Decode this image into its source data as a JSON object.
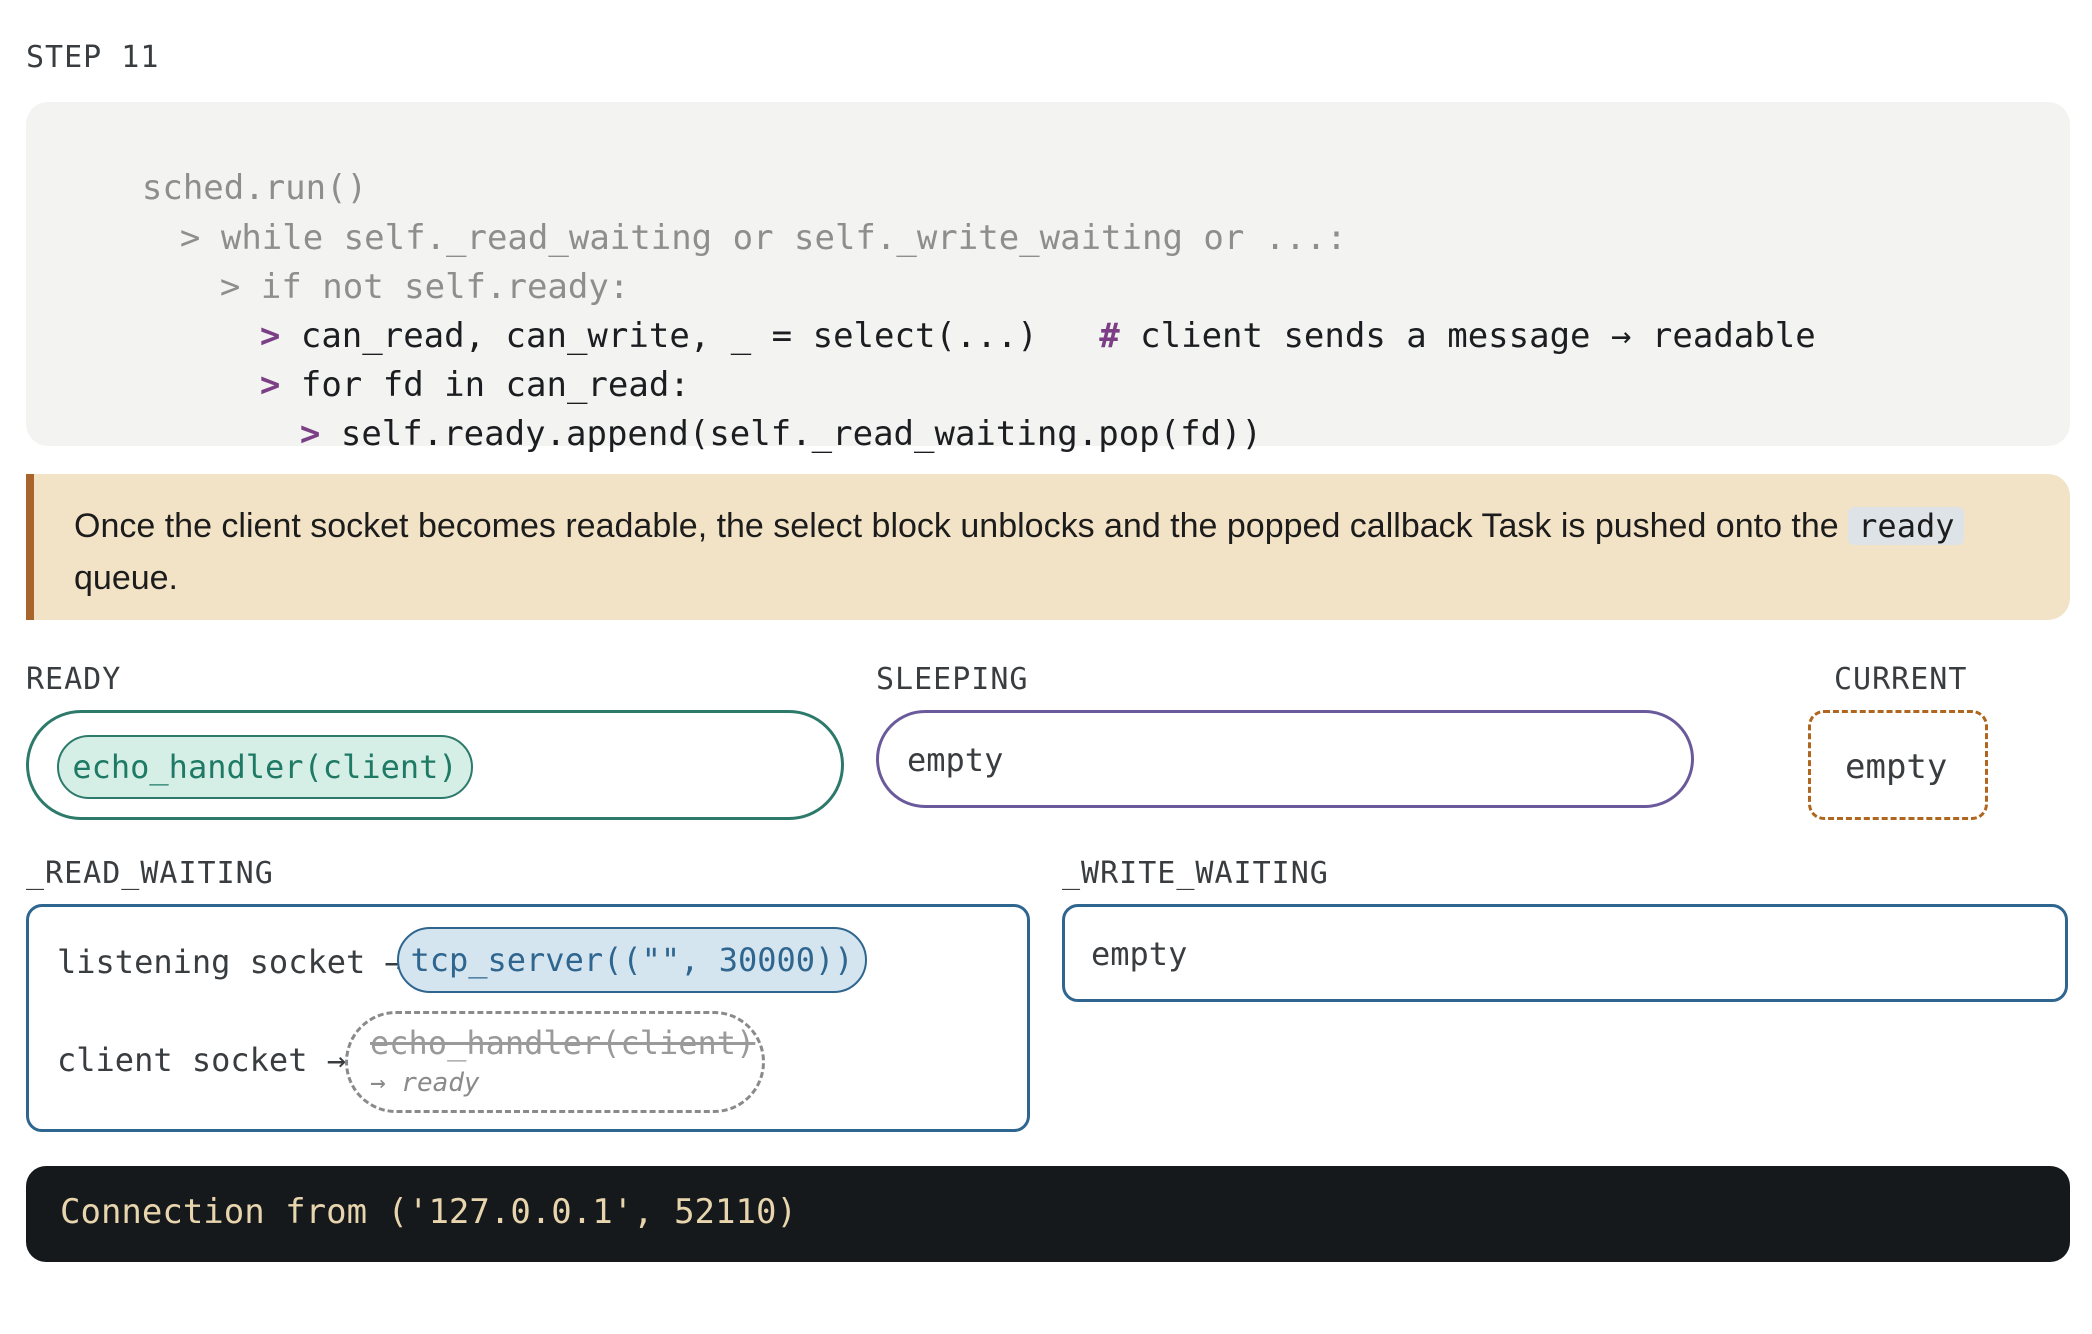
{
  "step": "STEP 11",
  "code": {
    "lines": [
      {
        "arrow": "",
        "text": "sched.run()",
        "state": "dim"
      },
      {
        "arrow": ">",
        "text": "while self._read_waiting or self._write_waiting or ...:",
        "state": "dim"
      },
      {
        "arrow": ">",
        "text": "if not self.ready:",
        "state": "dim"
      },
      {
        "arrow": ">",
        "text": "can_read, can_write, _ = select(...)",
        "state": "active",
        "comment_mark": "#",
        "comment": "client sends a message → readable"
      },
      {
        "arrow": ">",
        "text": "for fd in can_read:",
        "state": "active"
      },
      {
        "arrow": ">",
        "text": "self.ready.append(self._read_waiting.pop(fd))",
        "state": "active"
      }
    ]
  },
  "callout": {
    "text_before": "Once the client socket becomes readable, the select block unblocks and the popped callback Task is pushed onto the",
    "code": "ready",
    "text_after": "queue."
  },
  "queues": {
    "ready": {
      "label": "READY",
      "items": [
        "echo_handler(client)"
      ]
    },
    "sleeping": {
      "label": "SLEEPING",
      "empty": "empty"
    },
    "current": {
      "label": "CURRENT",
      "empty": "empty"
    }
  },
  "read_waiting": {
    "label": "_READ_WAITING",
    "rows": [
      {
        "key": "listening socket →",
        "task": "tcp_server((\"\", 30000))"
      },
      {
        "key": "client socket →",
        "task": "echo_handler(client)",
        "note": "→ ready"
      }
    ]
  },
  "write_waiting": {
    "label": "_WRITE_WAITING",
    "empty": "empty"
  },
  "console": {
    "output": "Connection from ('127.0.0.1', 52110)"
  },
  "colors": {
    "ready": "#2d7a6b",
    "sleeping": "#6a5a9c",
    "current": "#b0661e",
    "waiting": "#2f6690",
    "highlight_arrow": "#7c3f86",
    "callout_bg": "#f3e3c6",
    "console_bg": "#15191c"
  }
}
